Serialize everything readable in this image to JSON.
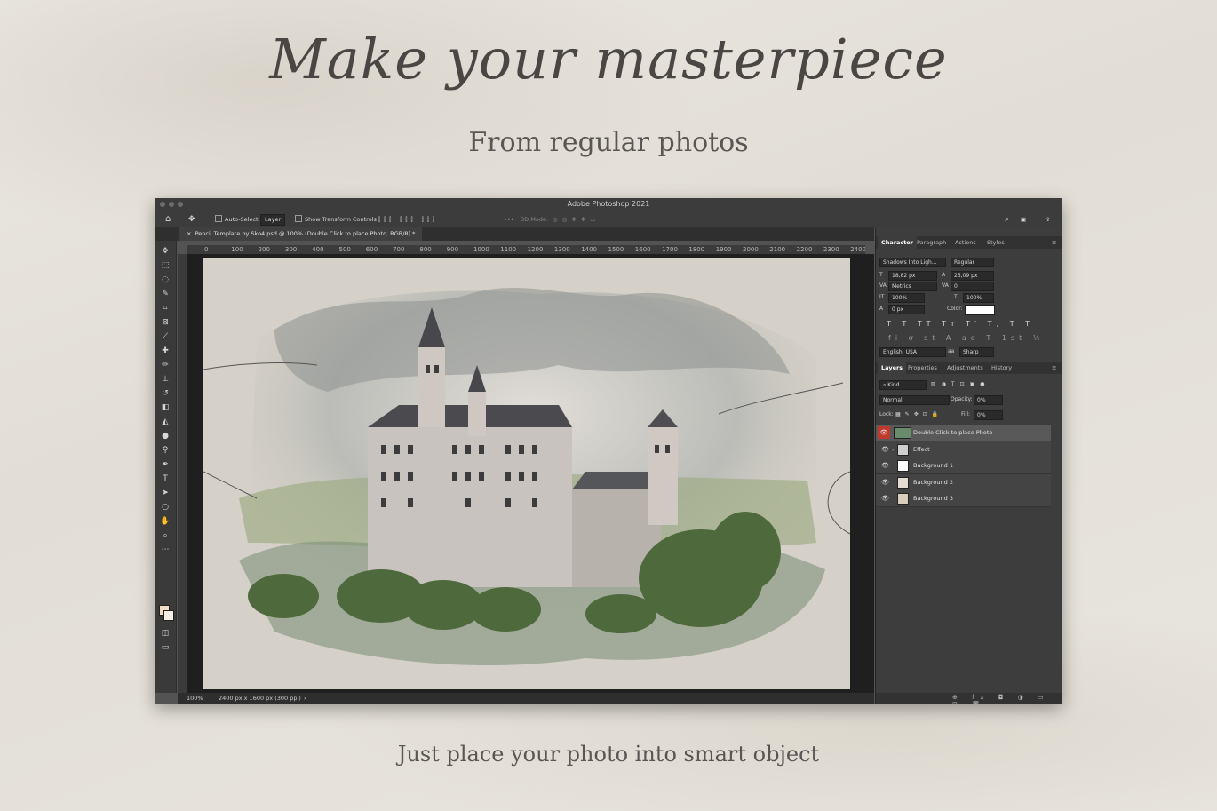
{
  "hero": {
    "headline": "Make your masterpiece",
    "subheadline": "From regular photos",
    "footer": "Just place your photo into smart object"
  },
  "window": {
    "title": "Adobe Photoshop 2021"
  },
  "options_bar": {
    "auto_select_label": "Auto-Select:",
    "auto_select_value": "Layer",
    "transform_label": "Show Transform Controls",
    "mode_label": "3D Mode:",
    "more": "•••"
  },
  "document": {
    "tab_title": "Pencil Template by Sko4.psd @ 100% (Double Click to place Photo, RGB/8) *",
    "zoom": "100%",
    "info": "2400 px x 1600 px (300 ppi)"
  },
  "ruler": {
    "ticks": [
      "0",
      "100",
      "200",
      "300",
      "400",
      "500",
      "600",
      "700",
      "800",
      "900",
      "1000",
      "1100",
      "1200",
      "1300",
      "1400",
      "1500",
      "1600",
      "1700",
      "1800",
      "1900",
      "2000",
      "2100",
      "2200",
      "2300",
      "2400"
    ]
  },
  "character_panel": {
    "tabs": [
      "Character",
      "Paragraph",
      "Actions",
      "Styles"
    ],
    "font_family": "Shadows Into Ligh...",
    "font_style": "Regular",
    "font_size": "18,82 px",
    "leading": "25,09 px",
    "kerning": "Metrics",
    "tracking": "0",
    "vertical_scale": "100%",
    "horizontal_scale": "100%",
    "baseline_shift": "0 px",
    "color_label": "Color:",
    "type_styles": "T T TT Tт T' T, T T",
    "opentype": "fi ơ st A ad T 1st ½",
    "language": "English: USA",
    "aa_label": "aa",
    "antialias": "Sharp"
  },
  "layers_panel": {
    "tabs": [
      "Layers",
      "Properties",
      "Adjustments",
      "History"
    ],
    "filter_kind": "Kind",
    "blend_mode": "Normal",
    "opacity_label": "Opacity:",
    "opacity_value": "0%",
    "lock_label": "Lock:",
    "fill_label": "Fill:",
    "fill_value": "0%",
    "layers": [
      {
        "name": "Double Click to place Photo",
        "selected": true,
        "thumb": "#6a8a6c"
      },
      {
        "name": "Effect",
        "group": true,
        "thumb": "#cfcfcf"
      },
      {
        "name": "Background 1",
        "thumb": "#ffffff"
      },
      {
        "name": "Background 2",
        "thumb": "#e4ddd2"
      },
      {
        "name": "Background 3",
        "thumb": "#d9cdbb"
      }
    ],
    "bottom_icons": "⊕ fx ◘ ◑ ▭ ⊞ 🗑"
  },
  "colors": {
    "accent_red": "#c0392b",
    "ps_dark": "#535353"
  }
}
